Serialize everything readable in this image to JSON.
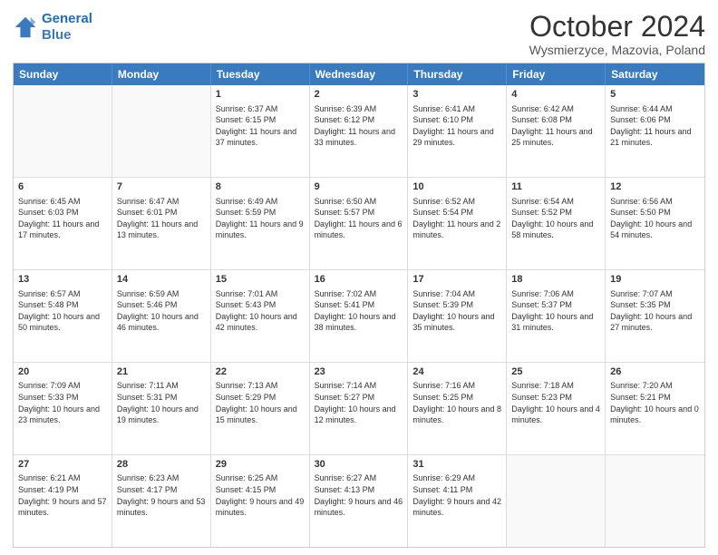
{
  "logo": {
    "line1": "General",
    "line2": "Blue"
  },
  "title": "October 2024",
  "location": "Wysmierzyce, Mazovia, Poland",
  "days": [
    "Sunday",
    "Monday",
    "Tuesday",
    "Wednesday",
    "Thursday",
    "Friday",
    "Saturday"
  ],
  "rows": [
    [
      {
        "day": "",
        "empty": true
      },
      {
        "day": "",
        "empty": true
      },
      {
        "day": "1",
        "sunrise": "Sunrise: 6:37 AM",
        "sunset": "Sunset: 6:15 PM",
        "daylight": "Daylight: 11 hours and 37 minutes."
      },
      {
        "day": "2",
        "sunrise": "Sunrise: 6:39 AM",
        "sunset": "Sunset: 6:12 PM",
        "daylight": "Daylight: 11 hours and 33 minutes."
      },
      {
        "day": "3",
        "sunrise": "Sunrise: 6:41 AM",
        "sunset": "Sunset: 6:10 PM",
        "daylight": "Daylight: 11 hours and 29 minutes."
      },
      {
        "day": "4",
        "sunrise": "Sunrise: 6:42 AM",
        "sunset": "Sunset: 6:08 PM",
        "daylight": "Daylight: 11 hours and 25 minutes."
      },
      {
        "day": "5",
        "sunrise": "Sunrise: 6:44 AM",
        "sunset": "Sunset: 6:06 PM",
        "daylight": "Daylight: 11 hours and 21 minutes."
      }
    ],
    [
      {
        "day": "6",
        "sunrise": "Sunrise: 6:45 AM",
        "sunset": "Sunset: 6:03 PM",
        "daylight": "Daylight: 11 hours and 17 minutes."
      },
      {
        "day": "7",
        "sunrise": "Sunrise: 6:47 AM",
        "sunset": "Sunset: 6:01 PM",
        "daylight": "Daylight: 11 hours and 13 minutes."
      },
      {
        "day": "8",
        "sunrise": "Sunrise: 6:49 AM",
        "sunset": "Sunset: 5:59 PM",
        "daylight": "Daylight: 11 hours and 9 minutes."
      },
      {
        "day": "9",
        "sunrise": "Sunrise: 6:50 AM",
        "sunset": "Sunset: 5:57 PM",
        "daylight": "Daylight: 11 hours and 6 minutes."
      },
      {
        "day": "10",
        "sunrise": "Sunrise: 6:52 AM",
        "sunset": "Sunset: 5:54 PM",
        "daylight": "Daylight: 11 hours and 2 minutes."
      },
      {
        "day": "11",
        "sunrise": "Sunrise: 6:54 AM",
        "sunset": "Sunset: 5:52 PM",
        "daylight": "Daylight: 10 hours and 58 minutes."
      },
      {
        "day": "12",
        "sunrise": "Sunrise: 6:56 AM",
        "sunset": "Sunset: 5:50 PM",
        "daylight": "Daylight: 10 hours and 54 minutes."
      }
    ],
    [
      {
        "day": "13",
        "sunrise": "Sunrise: 6:57 AM",
        "sunset": "Sunset: 5:48 PM",
        "daylight": "Daylight: 10 hours and 50 minutes."
      },
      {
        "day": "14",
        "sunrise": "Sunrise: 6:59 AM",
        "sunset": "Sunset: 5:46 PM",
        "daylight": "Daylight: 10 hours and 46 minutes."
      },
      {
        "day": "15",
        "sunrise": "Sunrise: 7:01 AM",
        "sunset": "Sunset: 5:43 PM",
        "daylight": "Daylight: 10 hours and 42 minutes."
      },
      {
        "day": "16",
        "sunrise": "Sunrise: 7:02 AM",
        "sunset": "Sunset: 5:41 PM",
        "daylight": "Daylight: 10 hours and 38 minutes."
      },
      {
        "day": "17",
        "sunrise": "Sunrise: 7:04 AM",
        "sunset": "Sunset: 5:39 PM",
        "daylight": "Daylight: 10 hours and 35 minutes."
      },
      {
        "day": "18",
        "sunrise": "Sunrise: 7:06 AM",
        "sunset": "Sunset: 5:37 PM",
        "daylight": "Daylight: 10 hours and 31 minutes."
      },
      {
        "day": "19",
        "sunrise": "Sunrise: 7:07 AM",
        "sunset": "Sunset: 5:35 PM",
        "daylight": "Daylight: 10 hours and 27 minutes."
      }
    ],
    [
      {
        "day": "20",
        "sunrise": "Sunrise: 7:09 AM",
        "sunset": "Sunset: 5:33 PM",
        "daylight": "Daylight: 10 hours and 23 minutes."
      },
      {
        "day": "21",
        "sunrise": "Sunrise: 7:11 AM",
        "sunset": "Sunset: 5:31 PM",
        "daylight": "Daylight: 10 hours and 19 minutes."
      },
      {
        "day": "22",
        "sunrise": "Sunrise: 7:13 AM",
        "sunset": "Sunset: 5:29 PM",
        "daylight": "Daylight: 10 hours and 15 minutes."
      },
      {
        "day": "23",
        "sunrise": "Sunrise: 7:14 AM",
        "sunset": "Sunset: 5:27 PM",
        "daylight": "Daylight: 10 hours and 12 minutes."
      },
      {
        "day": "24",
        "sunrise": "Sunrise: 7:16 AM",
        "sunset": "Sunset: 5:25 PM",
        "daylight": "Daylight: 10 hours and 8 minutes."
      },
      {
        "day": "25",
        "sunrise": "Sunrise: 7:18 AM",
        "sunset": "Sunset: 5:23 PM",
        "daylight": "Daylight: 10 hours and 4 minutes."
      },
      {
        "day": "26",
        "sunrise": "Sunrise: 7:20 AM",
        "sunset": "Sunset: 5:21 PM",
        "daylight": "Daylight: 10 hours and 0 minutes."
      }
    ],
    [
      {
        "day": "27",
        "sunrise": "Sunrise: 6:21 AM",
        "sunset": "Sunset: 4:19 PM",
        "daylight": "Daylight: 9 hours and 57 minutes."
      },
      {
        "day": "28",
        "sunrise": "Sunrise: 6:23 AM",
        "sunset": "Sunset: 4:17 PM",
        "daylight": "Daylight: 9 hours and 53 minutes."
      },
      {
        "day": "29",
        "sunrise": "Sunrise: 6:25 AM",
        "sunset": "Sunset: 4:15 PM",
        "daylight": "Daylight: 9 hours and 49 minutes."
      },
      {
        "day": "30",
        "sunrise": "Sunrise: 6:27 AM",
        "sunset": "Sunset: 4:13 PM",
        "daylight": "Daylight: 9 hours and 46 minutes."
      },
      {
        "day": "31",
        "sunrise": "Sunrise: 6:29 AM",
        "sunset": "Sunset: 4:11 PM",
        "daylight": "Daylight: 9 hours and 42 minutes."
      },
      {
        "day": "",
        "empty": true
      },
      {
        "day": "",
        "empty": true
      }
    ]
  ]
}
